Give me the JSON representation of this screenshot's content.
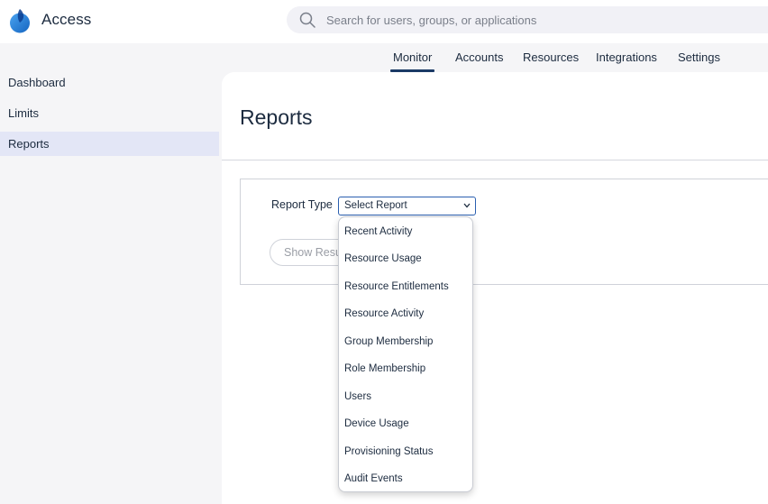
{
  "header": {
    "app_title": "Access",
    "search_placeholder": "Search for users, groups, or applications"
  },
  "topnav": {
    "tabs": [
      "Monitor",
      "Accounts",
      "Resources",
      "Integrations",
      "Settings"
    ],
    "active": "Monitor"
  },
  "sidebar": {
    "items": [
      "Dashboard",
      "Limits",
      "Reports"
    ],
    "active": "Reports"
  },
  "main": {
    "title": "Reports",
    "report_type_label": "Report Type",
    "select_value": "Select Report",
    "show_button_label": "Show Results"
  },
  "dropdown": {
    "options": [
      "Recent Activity",
      "Resource Usage",
      "Resource Entitlements",
      "Resource Activity",
      "Group Membership",
      "Role Membership",
      "Users",
      "Device Usage",
      "Provisioning Status",
      "Audit Events"
    ]
  },
  "icons": {
    "logo": "app-logo-icon",
    "search": "search-icon",
    "select_chevron": "chevron-down-icon"
  },
  "colors": {
    "accent": "#1b3a66",
    "sidebar_active": "#e3e6f6",
    "select_border": "#2a5fb0"
  }
}
